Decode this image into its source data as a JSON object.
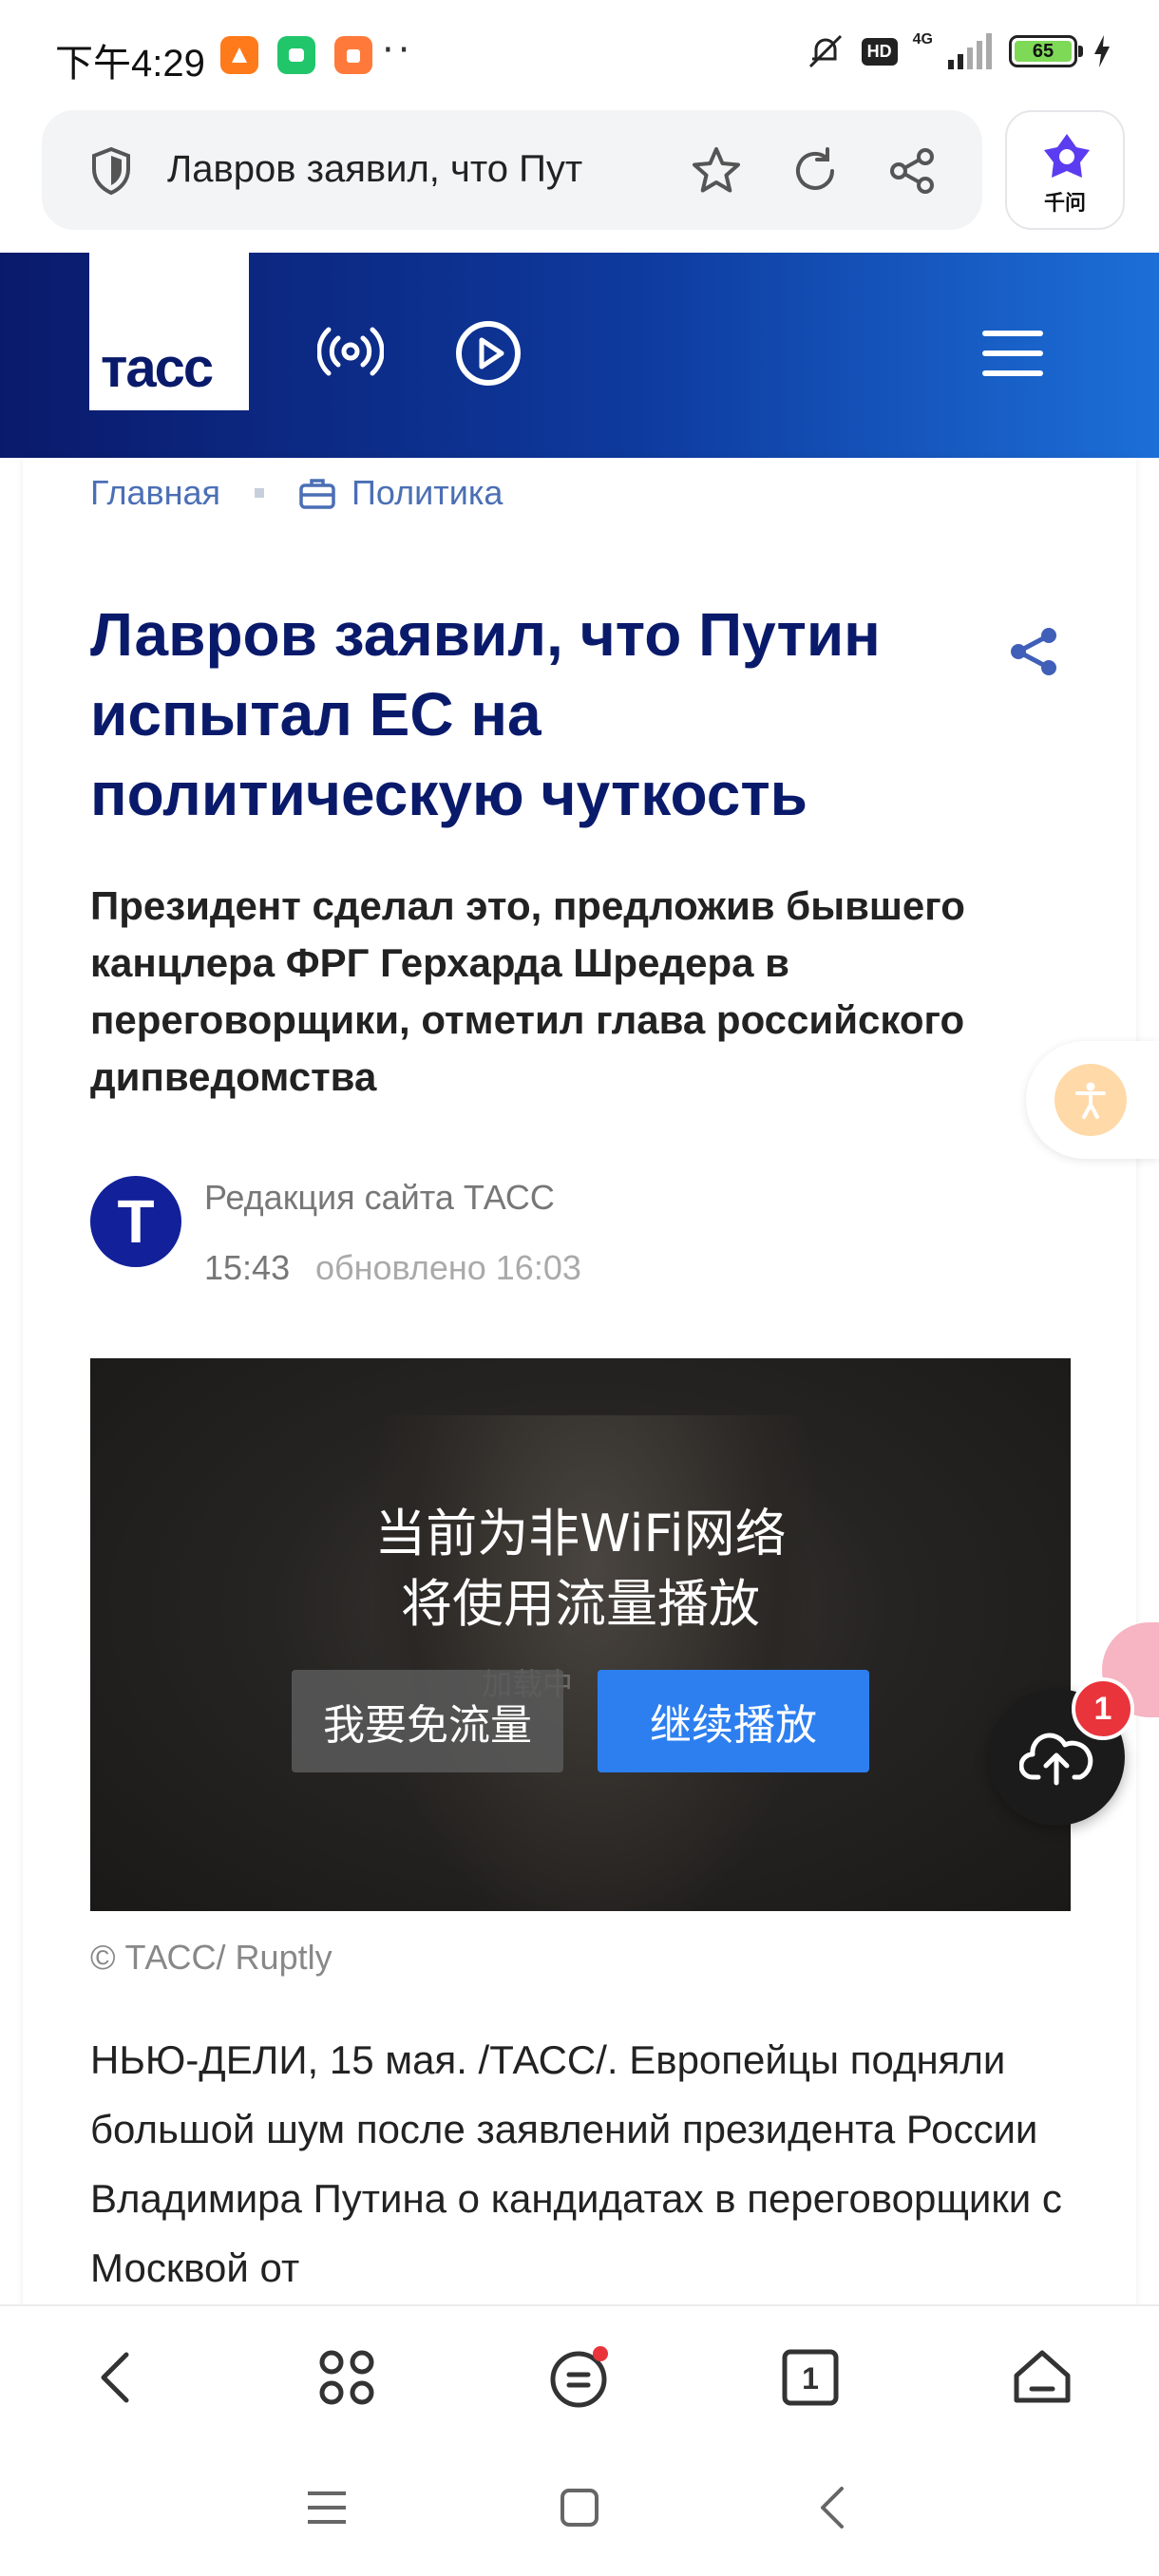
{
  "status_bar": {
    "time": "下午4:29",
    "network": "4G",
    "hd": "HD",
    "battery": "65",
    "more": "··"
  },
  "address_bar": {
    "url_text": "Лавров заявил, что Пут",
    "assistant_label": "千问"
  },
  "site": {
    "logo": "тасс"
  },
  "breadcrumb": {
    "home": "Главная",
    "section": "Политика"
  },
  "article": {
    "headline": "Лавров заявил, что Путин испытал ЕС на политическую чуткость",
    "subtitle": "Президент сделал это, предложив бывшего канцлера ФРГ Герхарда Шредера в переговорщики, отметил глава российского дипведомства",
    "author": "Редакция сайта ТАСС",
    "author_initial": "Т",
    "time": "15:43",
    "updated": "обновлено 16:03",
    "caption": "© ТАСС/ Ruptly",
    "body": "НЬЮ-ДЕЛИ, 15 мая. /ТАСС/. Европейцы подняли большой шум после заявлений президента России Владимира Путина о кандидатах в переговорщики с Москвой от"
  },
  "video": {
    "notice_line1": "当前为非WiFi网络",
    "notice_line2": "将使用流量播放",
    "loading": "加载中",
    "free_button": "我要免流量",
    "continue_button": "继续播放"
  },
  "upload_badge": "1",
  "colors": {
    "tass_navy": "#0a1a6b",
    "tass_blue": "#1c6fd8",
    "link_blue": "#4b6fb5",
    "continue_blue": "#2d7ff0",
    "badge_red": "#e9343c"
  },
  "icons": {
    "toolbar": [
      "back-icon",
      "apps-icon",
      "menu-icon",
      "tabs-icon",
      "home-icon"
    ],
    "nav": [
      "recents-icon",
      "home-square-icon",
      "back-triangle-icon"
    ]
  },
  "toolbar": {
    "tabs_count": "1"
  }
}
